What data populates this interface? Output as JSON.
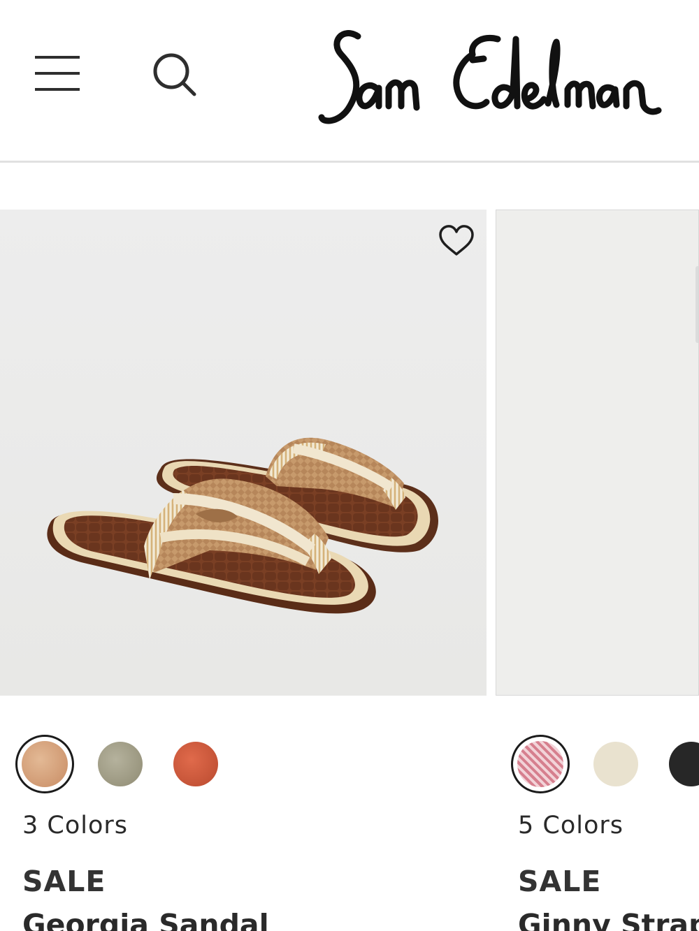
{
  "header": {
    "brand": "Sam Edelman",
    "icons": [
      "hamburger-menu-icon",
      "search-icon"
    ]
  },
  "products": [
    {
      "colors_label": "3 Colors",
      "badge": "SALE",
      "name": "Georgia Sandal",
      "swatches": [
        "#d9a985",
        "#a8a590",
        "#d05a3e"
      ],
      "selected_swatch": 0
    },
    {
      "colors_label": "5 Colors",
      "badge": "SALE",
      "name": "Ginny Strap",
      "swatches": [
        "#d7909d",
        "#ece5d3",
        "#2a2a2a"
      ],
      "selected_swatch": 0
    }
  ]
}
